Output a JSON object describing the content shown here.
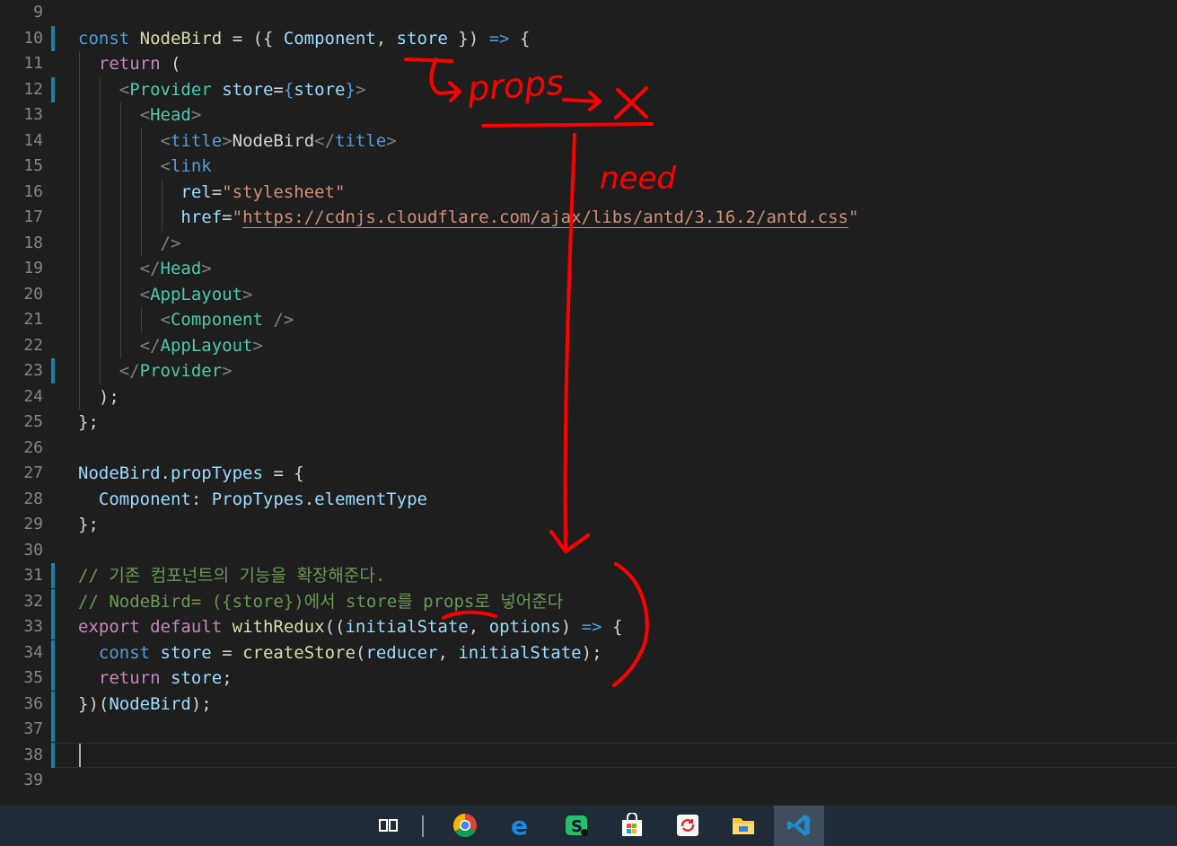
{
  "editor": {
    "lines": [
      {
        "n": "9",
        "segs": []
      },
      {
        "n": "10",
        "mark": true,
        "segs": [
          [
            "k",
            "const "
          ],
          [
            "f",
            "NodeBird"
          ],
          [
            "d",
            " = ({ "
          ],
          [
            "v",
            "Component"
          ],
          [
            "d",
            ", "
          ],
          [
            "v",
            "store"
          ],
          [
            "d",
            " }) "
          ],
          [
            "k",
            "=>"
          ],
          [
            "d",
            " {"
          ]
        ]
      },
      {
        "n": "11",
        "segs": [
          [
            "d",
            "  "
          ],
          [
            "c",
            "return"
          ],
          [
            "d",
            " ("
          ]
        ]
      },
      {
        "n": "12",
        "mark": true,
        "segs": [
          [
            "d",
            "    "
          ],
          [
            "p",
            "<"
          ],
          [
            "t",
            "Provider"
          ],
          [
            "d",
            " "
          ],
          [
            "v",
            "store"
          ],
          [
            "d",
            "="
          ],
          [
            "k",
            "{"
          ],
          [
            "v",
            "store"
          ],
          [
            "k",
            "}"
          ],
          [
            "p",
            ">"
          ]
        ]
      },
      {
        "n": "13",
        "segs": [
          [
            "d",
            "      "
          ],
          [
            "p",
            "<"
          ],
          [
            "t",
            "Head"
          ],
          [
            "p",
            ">"
          ]
        ]
      },
      {
        "n": "14",
        "segs": [
          [
            "d",
            "        "
          ],
          [
            "p",
            "<"
          ],
          [
            "k",
            "title"
          ],
          [
            "p",
            ">"
          ],
          [
            "d",
            "NodeBird"
          ],
          [
            "p",
            "</"
          ],
          [
            "k",
            "title"
          ],
          [
            "p",
            ">"
          ]
        ]
      },
      {
        "n": "15",
        "segs": [
          [
            "d",
            "        "
          ],
          [
            "p",
            "<"
          ],
          [
            "k",
            "link"
          ]
        ]
      },
      {
        "n": "16",
        "segs": [
          [
            "d",
            "          "
          ],
          [
            "v",
            "rel"
          ],
          [
            "d",
            "="
          ],
          [
            "s",
            "\"stylesheet\""
          ]
        ]
      },
      {
        "n": "17",
        "segs": [
          [
            "d",
            "          "
          ],
          [
            "v",
            "href"
          ],
          [
            "d",
            "="
          ],
          [
            "s",
            "\""
          ],
          [
            "u",
            "https://cdnjs.cloudflare.com/ajax/libs/antd/3.16.2/antd.css"
          ],
          [
            "s",
            "\""
          ]
        ]
      },
      {
        "n": "18",
        "segs": [
          [
            "d",
            "        "
          ],
          [
            "p",
            "/>"
          ]
        ]
      },
      {
        "n": "19",
        "segs": [
          [
            "d",
            "      "
          ],
          [
            "p",
            "</"
          ],
          [
            "t",
            "Head"
          ],
          [
            "p",
            ">"
          ]
        ]
      },
      {
        "n": "20",
        "segs": [
          [
            "d",
            "      "
          ],
          [
            "p",
            "<"
          ],
          [
            "t",
            "AppLayout"
          ],
          [
            "p",
            ">"
          ]
        ]
      },
      {
        "n": "21",
        "segs": [
          [
            "d",
            "        "
          ],
          [
            "p",
            "<"
          ],
          [
            "t",
            "Component"
          ],
          [
            "d",
            " "
          ],
          [
            "p",
            "/>"
          ]
        ]
      },
      {
        "n": "22",
        "segs": [
          [
            "d",
            "      "
          ],
          [
            "p",
            "</"
          ],
          [
            "t",
            "AppLayout"
          ],
          [
            "p",
            ">"
          ]
        ]
      },
      {
        "n": "23",
        "mark": true,
        "segs": [
          [
            "d",
            "    "
          ],
          [
            "p",
            "</"
          ],
          [
            "t",
            "Provider"
          ],
          [
            "p",
            ">"
          ]
        ]
      },
      {
        "n": "24",
        "segs": [
          [
            "d",
            "  );"
          ]
        ]
      },
      {
        "n": "25",
        "segs": [
          [
            "d",
            "};"
          ]
        ]
      },
      {
        "n": "26",
        "segs": []
      },
      {
        "n": "27",
        "segs": [
          [
            "v",
            "NodeBird"
          ],
          [
            "d",
            "."
          ],
          [
            "v",
            "propTypes"
          ],
          [
            "d",
            " = {"
          ]
        ]
      },
      {
        "n": "28",
        "segs": [
          [
            "d",
            "  "
          ],
          [
            "v",
            "Component"
          ],
          [
            "d",
            ": "
          ],
          [
            "v",
            "PropTypes"
          ],
          [
            "d",
            "."
          ],
          [
            "v",
            "elementType"
          ]
        ]
      },
      {
        "n": "29",
        "segs": [
          [
            "d",
            "};"
          ]
        ]
      },
      {
        "n": "30",
        "segs": []
      },
      {
        "n": "31",
        "mark": true,
        "segs": [
          [
            "cm",
            "// 기존 컴포넌트의 기능을 확장해준다."
          ]
        ]
      },
      {
        "n": "32",
        "mark": true,
        "segs": [
          [
            "cm",
            "// NodeBird= ({store})에서 store를 props로 넣어준다"
          ]
        ]
      },
      {
        "n": "33",
        "mark": true,
        "segs": [
          [
            "c",
            "export"
          ],
          [
            "d",
            " "
          ],
          [
            "c",
            "default"
          ],
          [
            "d",
            " "
          ],
          [
            "f",
            "withRedux"
          ],
          [
            "d",
            "(("
          ],
          [
            "v",
            "initialState"
          ],
          [
            "d",
            ", "
          ],
          [
            "v",
            "options"
          ],
          [
            "d",
            ") "
          ],
          [
            "k",
            "=>"
          ],
          [
            "d",
            " {"
          ]
        ]
      },
      {
        "n": "34",
        "mark": true,
        "segs": [
          [
            "d",
            "  "
          ],
          [
            "k",
            "const"
          ],
          [
            "d",
            " "
          ],
          [
            "v",
            "store"
          ],
          [
            "d",
            " = "
          ],
          [
            "f",
            "createStore"
          ],
          [
            "d",
            "("
          ],
          [
            "v",
            "reducer"
          ],
          [
            "d",
            ", "
          ],
          [
            "v",
            "initialState"
          ],
          [
            "d",
            ");"
          ]
        ]
      },
      {
        "n": "35",
        "mark": true,
        "segs": [
          [
            "d",
            "  "
          ],
          [
            "c",
            "return"
          ],
          [
            "d",
            " "
          ],
          [
            "v",
            "store"
          ],
          [
            "d",
            ";"
          ]
        ]
      },
      {
        "n": "36",
        "mark": true,
        "segs": [
          [
            "d",
            "})("
          ],
          [
            "v",
            "NodeBird"
          ],
          [
            "d",
            ");"
          ]
        ]
      },
      {
        "n": "37",
        "mark": true,
        "segs": []
      },
      {
        "n": "38",
        "mark": true,
        "current": true,
        "segs": []
      },
      {
        "n": "39",
        "segs": []
      }
    ]
  },
  "annotations": {
    "props_label": "props",
    "need_label": "need",
    "x_mark": "X",
    "color": "#ff0000"
  },
  "taskbar": {
    "items": [
      {
        "name": "task-view-button",
        "icon": "task-view-icon"
      },
      {
        "name": "chrome-button",
        "icon": "chrome-icon"
      },
      {
        "name": "edge-button",
        "icon": "edge-icon"
      },
      {
        "name": "app-s-button",
        "icon": "green-s-icon"
      },
      {
        "name": "store-button",
        "icon": "store-icon"
      },
      {
        "name": "sync-app-button",
        "icon": "sync-icon"
      },
      {
        "name": "file-explorer-button",
        "icon": "folder-icon"
      },
      {
        "name": "vscode-button",
        "icon": "vscode-icon",
        "active": true
      }
    ]
  }
}
